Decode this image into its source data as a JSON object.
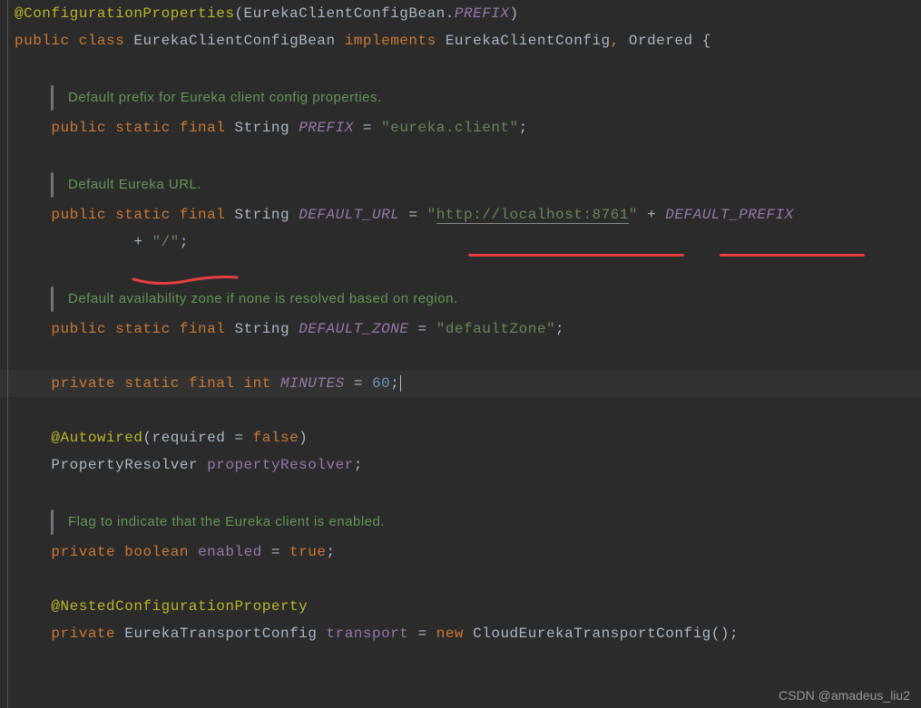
{
  "code": {
    "annotation_config_prop": "@ConfigurationProperties",
    "annotation_autowired": "@Autowired",
    "annotation_nested": "@NestedConfigurationProperty",
    "class_decl_public": "public",
    "class_decl_class": "class",
    "class_name": "EurekaClientConfigBean",
    "implements": "implements",
    "interface1": "EurekaClientConfig",
    "interface2": "Ordered",
    "prefix_ref_class": "EurekaClientConfigBean",
    "prefix_ref_field": "PREFIX",
    "kw_public": "public",
    "kw_private": "private",
    "kw_static": "static",
    "kw_final": "final",
    "kw_new": "new",
    "kw_int": "int",
    "kw_boolean": "boolean",
    "type_string": "String",
    "type_property_resolver": "PropertyResolver",
    "type_eureka_transport": "EurekaTransportConfig",
    "type_cloud_transport": "CloudEurekaTransportConfig",
    "const_prefix": "PREFIX",
    "const_default_url": "DEFAULT_URL",
    "const_default_prefix": "DEFAULT_PREFIX",
    "const_default_zone": "DEFAULT_ZONE",
    "const_minutes": "MINUTES",
    "str_eureka_client": "\"eureka.client\"",
    "str_http_localhost_open": "\"",
    "str_http_localhost": "http://localhost:8761",
    "str_http_localhost_close": "\"",
    "str_slash": "\"/\"",
    "str_default_zone": "\"defaultZone\"",
    "num_60": "60",
    "bool_true": "true",
    "bool_false": "false",
    "field_enabled": "enabled",
    "field_transport": "transport",
    "field_property_resolver": "propertyResolver",
    "param_required": "required",
    "eq": " = ",
    "plus": " + ",
    "semi": ";",
    "comma": ",",
    "lparen": "(",
    "rparen": ")",
    "lbrace": "{",
    "dot": "."
  },
  "docs": {
    "prefix": "Default prefix for Eureka client config properties.",
    "url": "Default Eureka URL.",
    "zone": "Default availability zone if none is resolved based on region.",
    "enabled": "Flag to indicate that the Eureka client is enabled."
  },
  "watermark": "CSDN @amadeus_liu2"
}
